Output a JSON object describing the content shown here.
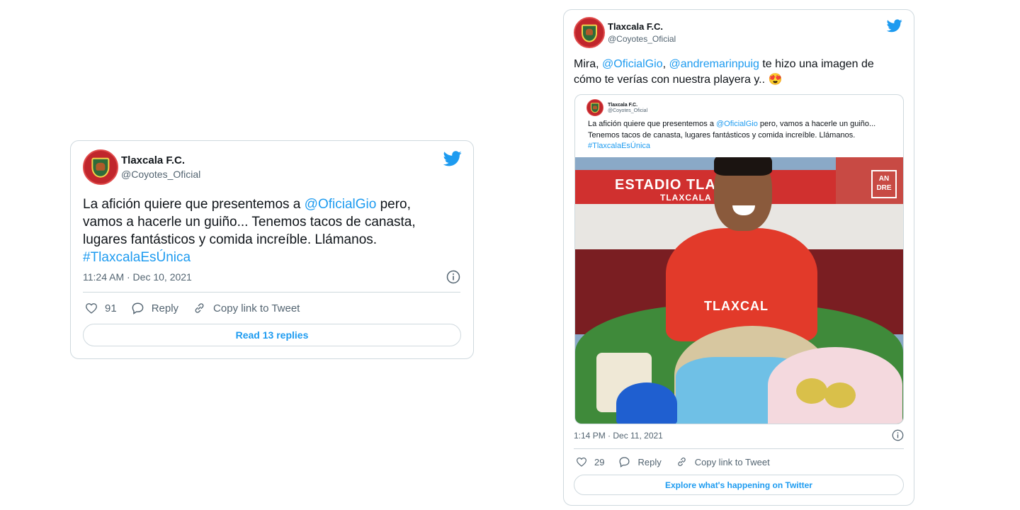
{
  "tweet1": {
    "display_name": "Tlaxcala F.C.",
    "handle": "@Coyotes_Oficial",
    "text_part1": "La afición quiere que presentemos a ",
    "mention": "@OficialGio",
    "text_part2": " pero, vamos a hacerle un guiño... Tenemos tacos de canasta, lugares fantásticos y comida increíble. Llámanos. ",
    "hashtag": "#TlaxcalaEsÚnica",
    "timestamp": "11:24 AM · Dec 10, 2021",
    "likes": "91",
    "reply_label": "Reply",
    "copy_link_label": "Copy link to Tweet",
    "read_replies_label": "Read 13 replies"
  },
  "tweet2": {
    "display_name": "Tlaxcala F.C.",
    "handle": "@Coyotes_Oficial",
    "text_part1": "Mira, ",
    "mention1": "@OficialGio",
    "text_sep": ", ",
    "mention2": "@andremarinpuig",
    "text_part2": " te hizo una imagen de cómo te verías con nuestra playera y.. ",
    "emoji": "😍",
    "timestamp": "1:14 PM · Dec 11, 2021",
    "likes": "29",
    "reply_label": "Reply",
    "copy_link_label": "Copy link to Tweet",
    "explore_label": "Explore what's happening on Twitter",
    "embedded_image": {
      "display_name": "Tlaxcala F.C.",
      "handle": "@Coyotes_Oficial",
      "text_part1": "La afición quiere que presentemos a ",
      "mention": "@OficialGio",
      "text_part2": " pero, vamos a hacerle un guiño... Tenemos tacos de canasta, lugares fantásticos y comida increíble. Llámanos. ",
      "hashtag": "#TlaxcalaEsÚnica",
      "stadium_sign": "ESTADIO TLAX",
      "stadium_sign_sub": "TLAXCALA",
      "logo_line1": "AN",
      "logo_line2": "DRE",
      "jersey_text": "TLAXCAL"
    }
  },
  "colors": {
    "accent": "#1d9bf0",
    "text": "#0f1419",
    "muted": "#536471",
    "border": "#cfd9de",
    "avatar_red": "#c0262c"
  },
  "icons": [
    "twitter-bird-icon",
    "heart-icon",
    "reply-icon",
    "link-icon",
    "info-icon"
  ]
}
